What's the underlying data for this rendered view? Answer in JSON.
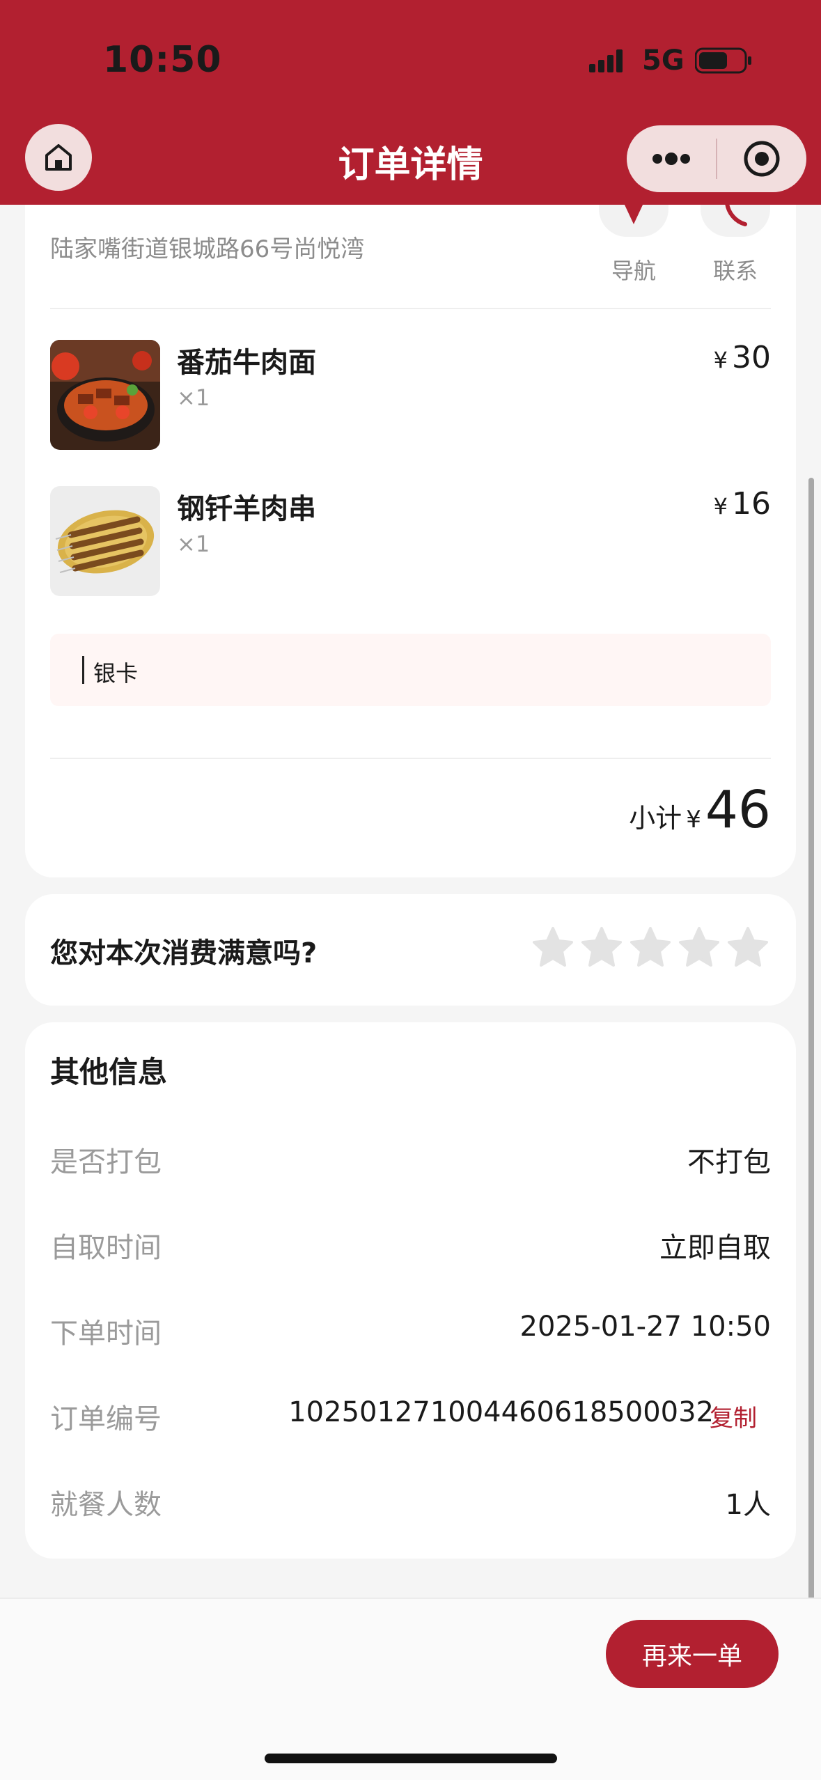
{
  "status_bar": {
    "time": "10:50",
    "network": "5G"
  },
  "header": {
    "title": "订单详情"
  },
  "store": {
    "address": "陆家嘴街道银城路66号尚悦湾",
    "nav_label": "导航",
    "contact_label": "联系"
  },
  "items": [
    {
      "name": "番茄牛肉面",
      "qty": "×1",
      "currency": "¥",
      "price": "30"
    },
    {
      "name": "钢钎羊肉串",
      "qty": "×1",
      "currency": "¥",
      "price": "16"
    }
  ],
  "note": "银卡",
  "subtotal": {
    "label": "小计",
    "currency": "¥",
    "amount": "46"
  },
  "rating": {
    "question": "您对本次消费满意吗?",
    "max_stars": 5,
    "selected": 0
  },
  "other_info": {
    "title": "其他信息",
    "rows": [
      {
        "label": "是否打包",
        "value": "不打包"
      },
      {
        "label": "自取时间",
        "value": "立即自取"
      },
      {
        "label": "下单时间",
        "value": "2025-01-27 10:50"
      },
      {
        "label": "订单编号",
        "value": "10250127100446061850003​2"
      },
      {
        "label": "就餐人数",
        "value": "1人"
      }
    ],
    "copy_label": "复制"
  },
  "footer": {
    "reorder_label": "再来一单"
  },
  "colors": {
    "brand": "#b22030",
    "note_bg": "#fff6f5"
  }
}
